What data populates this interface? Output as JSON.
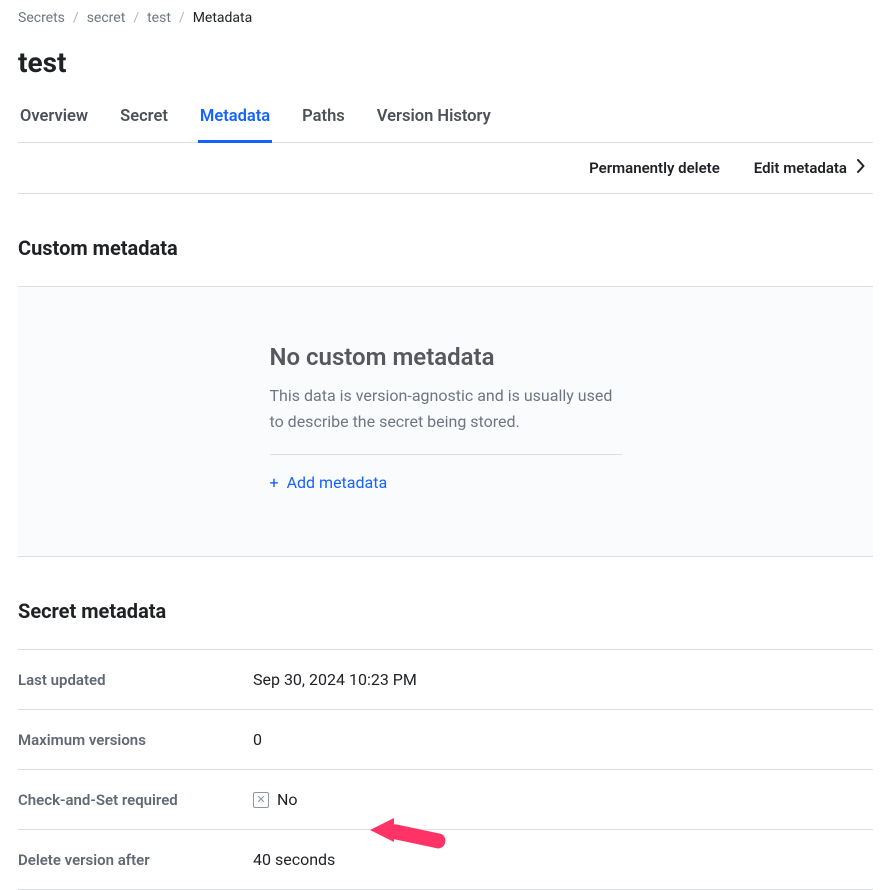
{
  "breadcrumb": {
    "items": [
      {
        "label": "Secrets"
      },
      {
        "label": "secret"
      },
      {
        "label": "test"
      },
      {
        "label": "Metadata"
      }
    ],
    "separator": "/"
  },
  "page_title": "test",
  "tabs": [
    {
      "label": "Overview"
    },
    {
      "label": "Secret"
    },
    {
      "label": "Metadata",
      "active": true
    },
    {
      "label": "Paths"
    },
    {
      "label": "Version History"
    }
  ],
  "action_bar": {
    "permanently_delete": "Permanently delete",
    "edit_metadata": "Edit metadata"
  },
  "custom_metadata": {
    "section_title": "Custom metadata",
    "empty_title": "No custom metadata",
    "empty_desc": "This data is version-agnostic and is usually used to describe the secret being stored.",
    "add_label": "Add metadata"
  },
  "secret_metadata": {
    "section_title": "Secret metadata",
    "rows": [
      {
        "key": "Last updated",
        "value": "Sep 30, 2024 10:23 PM"
      },
      {
        "key": "Maximum versions",
        "value": "0"
      },
      {
        "key": "Check-and-Set required",
        "value": "No",
        "icon": "x-square"
      },
      {
        "key": "Delete version after",
        "value": "40 seconds"
      }
    ]
  },
  "annotation": {
    "arrow_color": "#ff3366"
  }
}
